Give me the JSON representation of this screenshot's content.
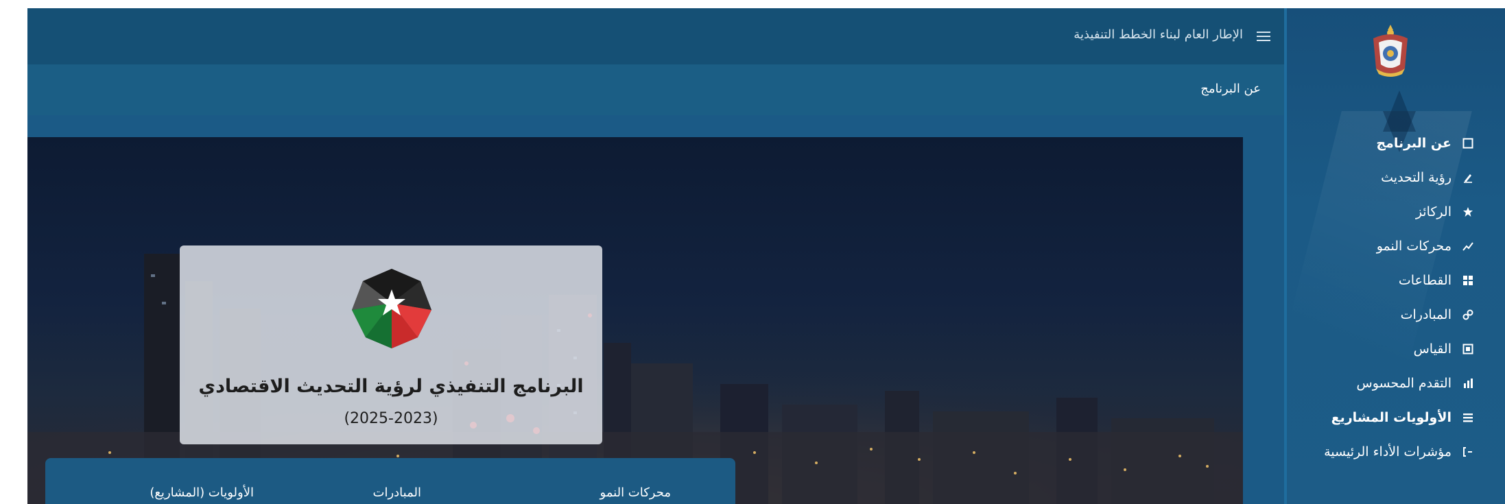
{
  "header": {
    "title": "الإطار العام لبناء الخطط التنفيذية"
  },
  "breadcrumb": {
    "current": "عن البرنامج"
  },
  "sidebar": {
    "items": [
      {
        "icon": "square-icon",
        "label": "عن البرنامج"
      },
      {
        "icon": "pencil-icon",
        "label": "رؤية التحديث"
      },
      {
        "icon": "star-icon",
        "label": "الركائز"
      },
      {
        "icon": "trend-icon",
        "label": "محركات النمو"
      },
      {
        "icon": "grid-icon",
        "label": "القطاعات"
      },
      {
        "icon": "link-icon",
        "label": "المبادرات"
      },
      {
        "icon": "box-icon",
        "label": "القياس"
      },
      {
        "icon": "chart-icon",
        "label": "التقدم المحسوس"
      },
      {
        "icon": "list-icon",
        "label": "الأولويات المشاريع"
      },
      {
        "icon": "bracket-icon",
        "label": "مؤشرات الأداء الرئيسية"
      }
    ]
  },
  "hero_card": {
    "title": "البرنامج التنفيذي لرؤية التحديث الاقتصادي",
    "years": "(2025-2023)"
  },
  "tabs": {
    "items": [
      "محركات النمو",
      "المبادرات",
      "الأولويات (المشاريع)"
    ]
  },
  "colors": {
    "header": "#155075",
    "subbar": "#1b5e85",
    "sidebar": "#1b5a86",
    "card": "#dcdfe6"
  }
}
